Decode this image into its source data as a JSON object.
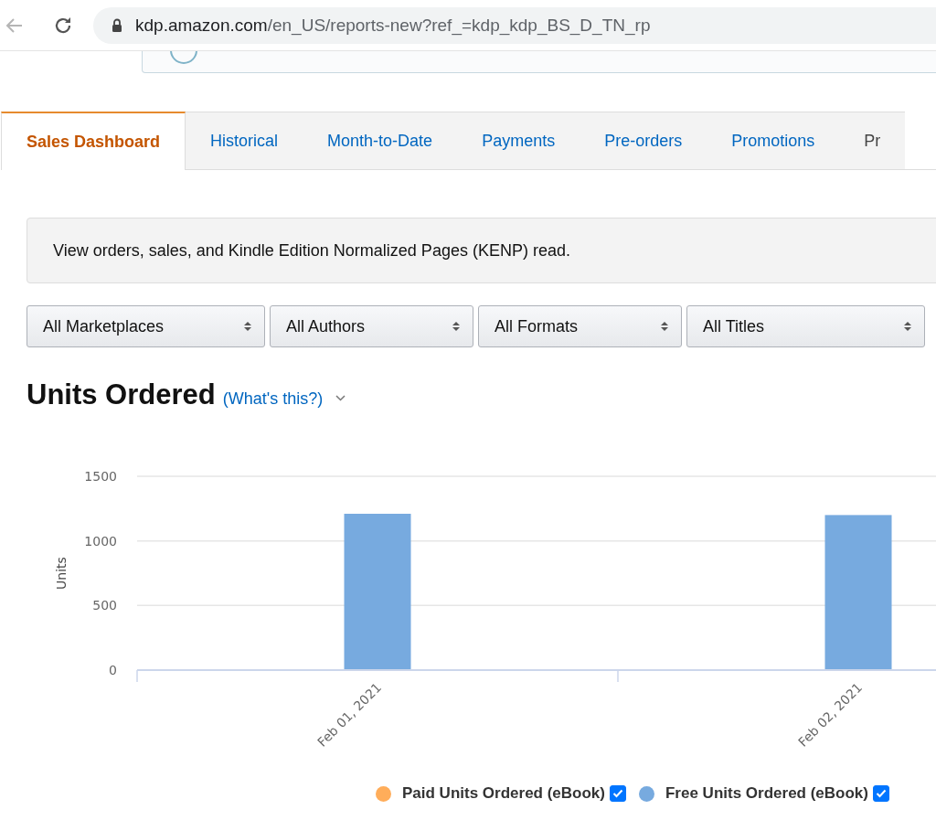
{
  "browser": {
    "url_host": "kdp.amazon.com",
    "url_path": "/en_US/reports-new?ref_=kdp_kdp_BS_D_TN_rp",
    "back_disabled": true
  },
  "tabs": [
    {
      "label": "Sales Dashboard",
      "selected": true
    },
    {
      "label": "Historical",
      "selected": false
    },
    {
      "label": "Month-to-Date",
      "selected": false
    },
    {
      "label": "Payments",
      "selected": false
    },
    {
      "label": "Pre-orders",
      "selected": false
    },
    {
      "label": "Promotions",
      "selected": false
    },
    {
      "label": "Pr",
      "selected": false
    }
  ],
  "description": "View orders, sales, and Kindle Edition Normalized Pages (KENP) read.",
  "filters": [
    {
      "value": "All Marketplaces"
    },
    {
      "value": "All Authors"
    },
    {
      "value": "All Formats"
    },
    {
      "value": "All Titles"
    }
  ],
  "heading": {
    "title": "Units Ordered",
    "help_link": "(What's this?)"
  },
  "chart_data": {
    "type": "bar",
    "ylabel": "Units",
    "categories": [
      "Feb 01, 2021",
      "Feb 02, 2021"
    ],
    "series": [
      {
        "name": "Paid Units Ordered (eBook)",
        "color": "#ffad5a",
        "values": [
          0,
          0
        ]
      },
      {
        "name": "Free Units Ordered (eBook)",
        "color": "#77aadf",
        "values": [
          1210,
          1200
        ]
      }
    ],
    "ylim": [
      0,
      1500
    ],
    "yticks": [
      0,
      500,
      1000,
      1500
    ]
  },
  "legend": [
    {
      "checked": true
    },
    {
      "checked": true
    }
  ]
}
